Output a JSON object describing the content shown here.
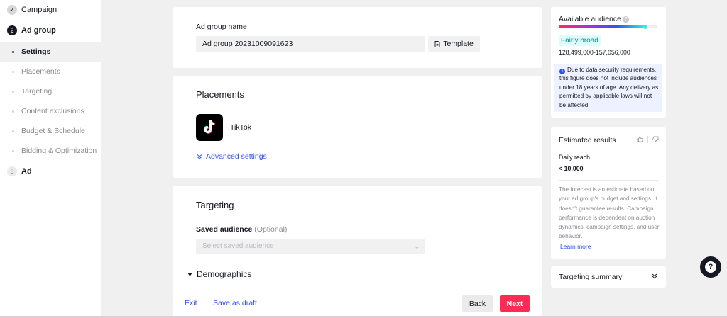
{
  "nav": {
    "steps": [
      {
        "num": "✓",
        "label": "Campaign"
      },
      {
        "num": "2",
        "label": "Ad group"
      },
      {
        "num": "3",
        "label": "Ad"
      }
    ],
    "subitems": [
      "Settings",
      "Placements",
      "Targeting",
      "Content exclusions",
      "Budget & Schedule",
      "Bidding & Optimization"
    ]
  },
  "adgroup": {
    "label": "Ad group name",
    "value": "Ad group 20231009091623",
    "template_label": "Template"
  },
  "placements": {
    "title": "Placements",
    "app": "TikTok",
    "advanced": "Advanced settings"
  },
  "targeting": {
    "title": "Targeting",
    "saved_label": "Saved audience",
    "optional": "(Optional)",
    "saved_placeholder": "Select saved audience",
    "demographics": "Demographics"
  },
  "actions": {
    "exit": "Exit",
    "save_draft": "Save as draft",
    "back": "Back",
    "next": "Next"
  },
  "audience": {
    "title": "Available audience",
    "level": "Fairly broad",
    "level_fraction": 0.88,
    "range": "128,499,000-157,056,000",
    "notice": "Due to data security requirements, this figure does not include audiences under 18 years of age. Any delivery as permitted by applicable laws will not be affected."
  },
  "estimate": {
    "title": "Estimated results",
    "reach_label": "Daily reach",
    "reach_value": "< 10,000",
    "forecast": "The forecast is an estimate based on your ad group's budget and settings. It doesn't guarantee results. Campaign performance is dependent on auction dynamics, campaign settings, and user behavior.",
    "learn_more": "Learn more"
  },
  "summary": {
    "title": "Targeting summary"
  },
  "colors": {
    "accent": "#fe2c55",
    "link": "#2f54eb",
    "cyan": "#25f4ee"
  },
  "icons": [
    "check-icon",
    "template-doc-icon",
    "tiktok-logo-icon",
    "double-chevron-down-icon",
    "caret-down-icon",
    "chevron-down-icon",
    "question-circle-icon",
    "info-icon",
    "thumbs-up-icon",
    "thumbs-down-icon",
    "help-icon"
  ]
}
